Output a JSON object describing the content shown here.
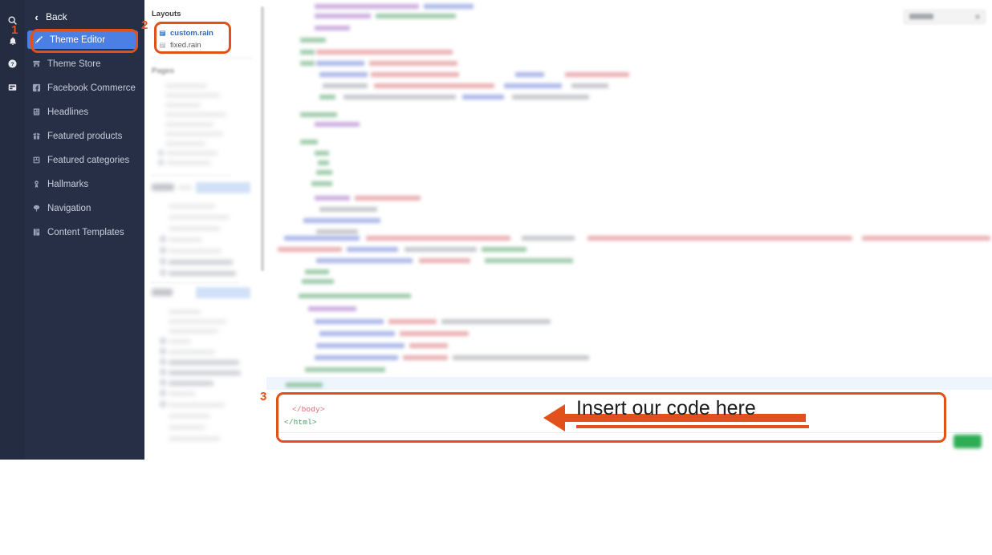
{
  "rail": {
    "icons": [
      {
        "name": "search-icon",
        "label": "Search"
      },
      {
        "name": "bell-icon",
        "label": "Notifications"
      },
      {
        "name": "help-icon",
        "label": "Help"
      },
      {
        "name": "inbox-icon",
        "label": "Inbox"
      }
    ]
  },
  "sidebar": {
    "back_label": "Back",
    "back_icon": "chevron-left-icon",
    "items": [
      {
        "label": "Theme Editor",
        "icon": "brush-icon",
        "active": true
      },
      {
        "label": "Theme Store",
        "icon": "store-icon",
        "active": false
      },
      {
        "label": "Facebook Commerce",
        "icon": "facebook-icon",
        "active": false
      },
      {
        "label": "Headlines",
        "icon": "headlines-icon",
        "active": false
      },
      {
        "label": "Featured products",
        "icon": "products-icon",
        "active": false
      },
      {
        "label": "Featured categories",
        "icon": "categories-icon",
        "active": false
      },
      {
        "label": "Hallmarks",
        "icon": "medal-icon",
        "active": false
      },
      {
        "label": "Navigation",
        "icon": "navigation-icon",
        "active": false
      },
      {
        "label": "Content Templates",
        "icon": "templates-icon",
        "active": false
      }
    ]
  },
  "filepanel": {
    "layouts_title": "Layouts",
    "pages_title": "Pages",
    "files": [
      {
        "name": "custom.rain",
        "selected": true
      },
      {
        "name": "fixed.rain",
        "selected": false
      }
    ]
  },
  "editor": {
    "code_lines": [
      {
        "text": "</body>",
        "color": "red"
      },
      {
        "text": "</html>",
        "color": "green"
      }
    ]
  },
  "annotations": {
    "steps": [
      {
        "number": "1",
        "target": "theme-editor-nav-item"
      },
      {
        "number": "2",
        "target": "layouts-file-list"
      },
      {
        "number": "3",
        "target": "code-insert-area"
      }
    ],
    "callout": "Insert our code here"
  },
  "colors": {
    "sidebar_bg": "#262f45",
    "rail_bg": "#232c41",
    "active_nav": "#4b7fe3",
    "annotation": "#e2511c",
    "save_button": "#23a94b",
    "link_blue": "#2b6cb8",
    "code_red": "#e2656e",
    "code_green": "#3f9a5a"
  }
}
